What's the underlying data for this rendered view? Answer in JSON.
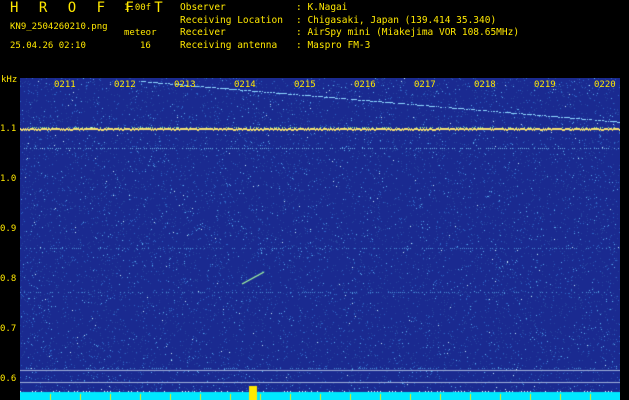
{
  "header": {
    "title": "H R O F F T",
    "version": "1.00f",
    "filename": "KN9_2504260210.png",
    "meteor_label": "meteor",
    "datetime": "25.04.26 02:10",
    "meteor_count": "16"
  },
  "info": [
    {
      "label": "Observer",
      "value": ": K.Nagai"
    },
    {
      "label": "Receiving Location",
      "value": ": Chigasaki, Japan (139.414 35.340)"
    },
    {
      "label": "Receiver",
      "value": ": AirSpy mini (Miakejima VOR 108.65MHz)"
    },
    {
      "label": "Receiving antenna",
      "value": ": Maspro FM-3"
    }
  ],
  "axis": {
    "unit": "kHz",
    "time_ticks": [
      "0211",
      "0212",
      "0213",
      "0214",
      "0215",
      "0216",
      "0217",
      "0218",
      "0219",
      "0220"
    ],
    "freq_ticks": [
      "1.1",
      "1.0",
      "0.9",
      "0.8",
      "0.7",
      "0.6"
    ]
  },
  "colors": {
    "text": "#ffe800",
    "background": "#000000",
    "spectrogram_bg": "#1a2a90",
    "noise": "#3a7ad8",
    "carrier": "#ffe060",
    "baseline": "#00e8ff",
    "marker": "#ffe800"
  }
}
